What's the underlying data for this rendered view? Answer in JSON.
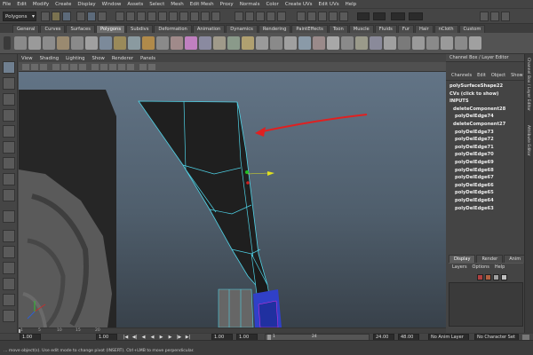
{
  "menubar": {
    "items": [
      "File",
      "Edit",
      "Modify",
      "Create",
      "Display",
      "Window",
      "Assets",
      "Select",
      "Mesh",
      "Edit Mesh",
      "Proxy",
      "Normals",
      "Color",
      "Create UVs",
      "Edit UVs",
      "Help"
    ]
  },
  "status_line": {
    "mode": "Polygons"
  },
  "shelf": {
    "tabs": [
      "General",
      "Curves",
      "Surfaces",
      "Polygons",
      "Subdivs",
      "Deformation",
      "Animation",
      "Dynamics",
      "Rendering",
      "PaintEffects",
      "Toon",
      "Muscle",
      "Fluids",
      "Fur",
      "Hair",
      "nCloth",
      "Custom"
    ],
    "active_tab": "Polygons"
  },
  "viewport": {
    "menu": [
      "View",
      "Shading",
      "Lighting",
      "Show",
      "Renderer",
      "Panels"
    ]
  },
  "channel_box": {
    "title": "Channel Box / Layer Editor",
    "menu": [
      "Channels",
      "Edit",
      "Object",
      "Show"
    ],
    "shape": "polySurfaceShape22",
    "cvs": "CVs (click to show)",
    "inputs_label": "INPUTS",
    "inputs": [
      "deleteComponent28",
      "polyDelEdge74",
      "deleteComponent27",
      "polyDelEdge73",
      "polyDelEdge72",
      "polyDelEdge71",
      "polyDelEdge70",
      "polyDelEdge69",
      "polyDelEdge68",
      "polyDelEdge67",
      "polyDelEdge66",
      "polyDelEdge65",
      "polyDelEdge64",
      "polyDelEdge63"
    ]
  },
  "side_tabs": {
    "channel": "Channel Box / Layer Editor",
    "attribute": "Attribute Editor"
  },
  "layer_editor": {
    "tabs": [
      "Display",
      "Render",
      "Anim"
    ],
    "active_tab": "Display",
    "menu": [
      "Layers",
      "Options",
      "Help"
    ]
  },
  "time_slider": {
    "ticks": [
      "1",
      "5",
      "10",
      "15",
      "20"
    ]
  },
  "range_slider": {
    "start_time": "1.00",
    "current_frame": "1.00",
    "playback_start": "1.00",
    "range_start_label": "1",
    "range_end_label": "24",
    "playback_end": "24.00",
    "end_time": "48.00",
    "anim_layer": "No Anim Layer",
    "character_set": "No Character Set"
  },
  "help_line": {
    "text": "... move object(s). Use edit mode to change pivot (INSERT). Ctrl+LMB to move perpendicular."
  },
  "colors": {
    "mesh_wire": "#4fd2e6",
    "annotation_arrow": "#e02020",
    "selection_blue": "#3040c8"
  }
}
